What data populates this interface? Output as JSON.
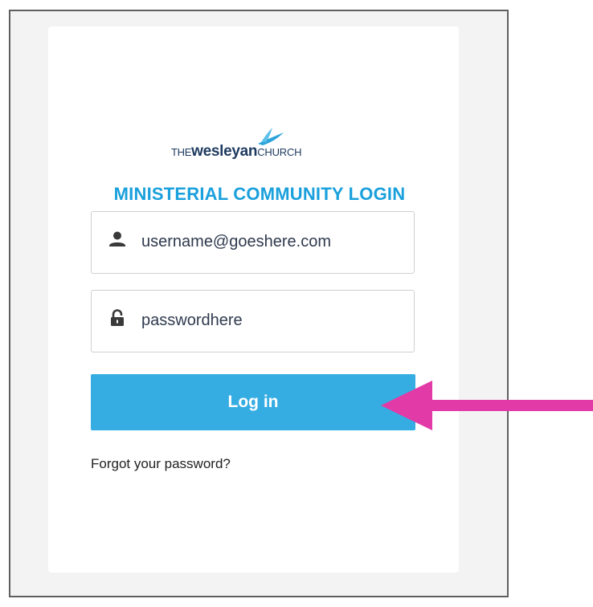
{
  "logo": {
    "the": "THE",
    "wesleyan": "wesleyan",
    "church": "CHURCH",
    "colors": {
      "text": "#1e3a5f",
      "bird": "#2ba3dc"
    }
  },
  "title": "MINISTERIAL COMMUNITY LOGIN",
  "username": {
    "icon": "user-icon",
    "value": "username@goeshere.com"
  },
  "password": {
    "icon": "lock-icon",
    "value": "passwordhere"
  },
  "login_button": {
    "label": "Log in",
    "color": "#36ade2"
  },
  "forgot_link": "Forgot your password?",
  "annotation": {
    "icon": "arrow-left-icon",
    "color": "#e23aa6"
  },
  "colors": {
    "accent": "#1aa0dc",
    "frame_bg": "#f3f3f3"
  }
}
